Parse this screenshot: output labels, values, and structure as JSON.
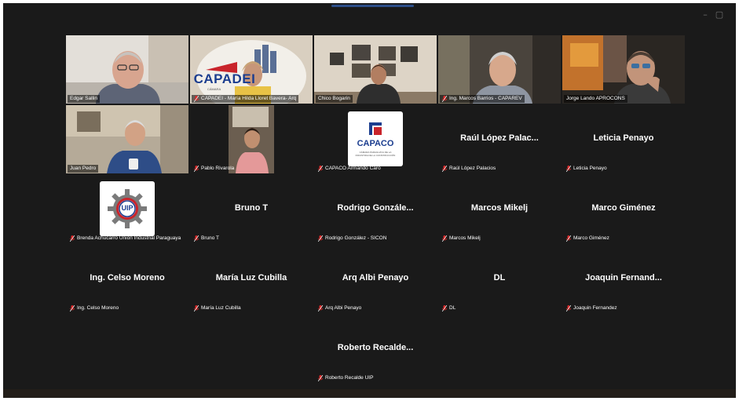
{
  "window": {
    "controls": [
      "–",
      "▢",
      "✕"
    ]
  },
  "participants": [
    {
      "id": "p1",
      "tile_name": "",
      "label": "Edgar Sallin",
      "video": true,
      "muted": false,
      "active": false
    },
    {
      "id": "p2",
      "tile_name": "",
      "label": "CAPADEI - María Hilda Lloret Bavera- Arq",
      "video": true,
      "muted": true,
      "active": false,
      "wall_text": "CAPADEI",
      "wall_subtext": "CÁMARA"
    },
    {
      "id": "p3",
      "tile_name": "",
      "label": "Chico Bogarin",
      "video": true,
      "muted": false,
      "active": false
    },
    {
      "id": "p4",
      "tile_name": "",
      "label": "Ing. Marcos Barrios - CAPAREV",
      "video": true,
      "muted": true,
      "active": false
    },
    {
      "id": "p5",
      "tile_name": "",
      "label": "Jorge Lando APROCONS",
      "video": true,
      "muted": false,
      "active": false
    },
    {
      "id": "p6",
      "tile_name": "",
      "label": "Juan Pedro",
      "video": true,
      "muted": false,
      "active": true
    },
    {
      "id": "p7",
      "tile_name": "",
      "label": "Pablo Rivarola",
      "video": true,
      "muted": true,
      "active": false
    },
    {
      "id": "p8",
      "tile_name": "",
      "label": "CAPACO Armando Caro",
      "video": false,
      "muted": true,
      "active": false,
      "logo": "CAPACO",
      "logo_sub": "CÁMARA PARAGUAYA DE LA INDUSTRIA DE LA CONSTRUCCIÓN"
    },
    {
      "id": "p9",
      "tile_name": "Raúl López Palac...",
      "label": "Raúl López Palacios",
      "video": false,
      "muted": true,
      "active": false
    },
    {
      "id": "p10",
      "tile_name": "Leticia Penayo",
      "label": "Leticia Penayo",
      "video": false,
      "muted": true,
      "active": false
    },
    {
      "id": "p11",
      "tile_name": "",
      "label": "Brenda Achucarro Unión Industrial Paraguaya",
      "video": false,
      "muted": true,
      "active": false,
      "logo": "UIP"
    },
    {
      "id": "p12",
      "tile_name": "Bruno T",
      "label": "Bruno T",
      "video": false,
      "muted": true,
      "active": false
    },
    {
      "id": "p13",
      "tile_name": "Rodrigo Gonzále...",
      "label": "Rodrigo González - SICON",
      "video": false,
      "muted": true,
      "active": false
    },
    {
      "id": "p14",
      "tile_name": "Marcos Mikelj",
      "label": "Marcos Mikelj",
      "video": false,
      "muted": true,
      "active": false
    },
    {
      "id": "p15",
      "tile_name": "Marco Giménez",
      "label": "Marco Giménez",
      "video": false,
      "muted": true,
      "active": false
    },
    {
      "id": "p16",
      "tile_name": "Ing. Celso Moreno",
      "label": "Ing. Celso Moreno",
      "video": false,
      "muted": true,
      "active": false
    },
    {
      "id": "p17",
      "tile_name": "María Luz Cubilla",
      "label": "María Luz Cubilla",
      "video": false,
      "muted": true,
      "active": false
    },
    {
      "id": "p18",
      "tile_name": "Arq Albi Penayo",
      "label": "Arq Albi Penayo",
      "video": false,
      "muted": true,
      "active": false
    },
    {
      "id": "p19",
      "tile_name": "DL",
      "label": "DL",
      "video": false,
      "muted": true,
      "active": false
    },
    {
      "id": "p20",
      "tile_name": "Joaquin Fernand...",
      "label": "Joaquin Fernandez",
      "video": false,
      "muted": true,
      "active": false
    },
    {
      "id": "p21",
      "tile_name": "Roberto Recalde...",
      "label": "Roberto Recalde UIP",
      "video": false,
      "muted": true,
      "active": false
    }
  ],
  "colors": {
    "background": "#1a1a1a",
    "active_speaker": "#23d959",
    "muted": "#e02828",
    "name_text": "#ffffff"
  }
}
